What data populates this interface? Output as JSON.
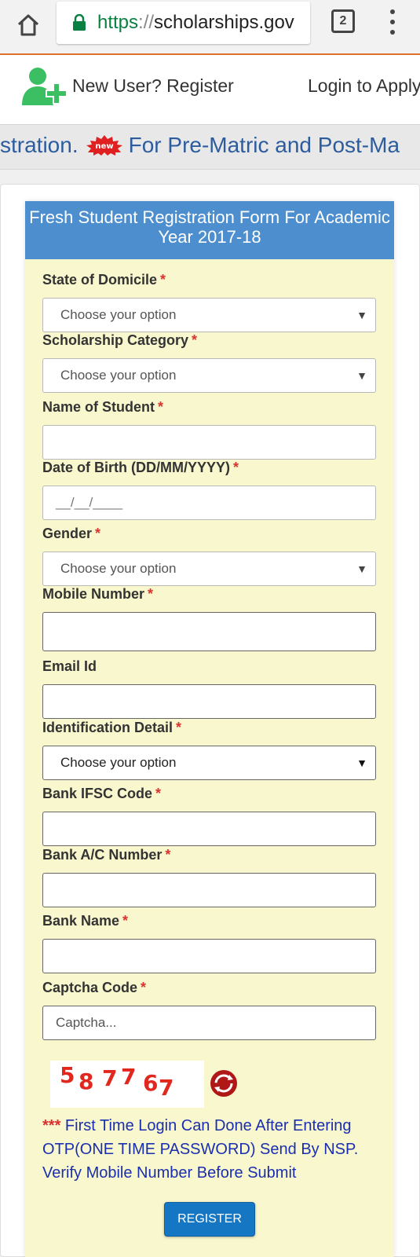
{
  "browser": {
    "home_icon": "home-icon",
    "url_scheme": "https",
    "url_sep": "://",
    "url_host": "scholarships.gov",
    "tab_count": "2",
    "menu_icon": "more-vert-icon"
  },
  "nav": {
    "register_label": "New User? Register",
    "login_label": "Login to Apply"
  },
  "marquee": {
    "text_before": "stration.",
    "badge": "new",
    "text_after": "For Pre-Matric and Post-Ma"
  },
  "form": {
    "title": "Fresh Student Registration Form For Academic Year 2017-18",
    "required_mark": "*",
    "fields": {
      "state": {
        "label": "State of Domicile",
        "value": "Choose your option"
      },
      "scholarship": {
        "label": "Scholarship Category",
        "value": "Choose your option"
      },
      "name": {
        "label": "Name of Student",
        "value": ""
      },
      "dob": {
        "label": "Date of Birth (DD/MM/YYYY)",
        "placeholder": "__/__/____"
      },
      "gender": {
        "label": "Gender",
        "value": "Choose your option"
      },
      "mobile": {
        "label": "Mobile Number",
        "value": ""
      },
      "email": {
        "label": "Email Id",
        "value": ""
      },
      "identification": {
        "label": "Identification Detail",
        "value": "Choose your option"
      },
      "ifsc": {
        "label": "Bank IFSC Code",
        "value": ""
      },
      "account": {
        "label": "Bank A/C Number",
        "value": ""
      },
      "bank": {
        "label": "Bank Name",
        "value": ""
      },
      "captcha": {
        "label": "Captcha Code",
        "placeholder": "Captcha..."
      }
    },
    "captcha_chars": [
      "5",
      "8",
      "7",
      "7",
      "6",
      "7"
    ],
    "notice_stars": "***",
    "notice_text": "First Time Login Can Done After Entering OTP(ONE TIME PASSWORD) Send By NSP. Verify Mobile Number Before Submit",
    "register_label": "REGISTER"
  },
  "colors": {
    "header_blue": "#4d8ecf",
    "form_bg": "#f9f7cd",
    "required_red": "#d9332f",
    "notice_blue": "#1a2fb0",
    "button_blue": "#1577c4",
    "url_green": "#0b8043"
  }
}
